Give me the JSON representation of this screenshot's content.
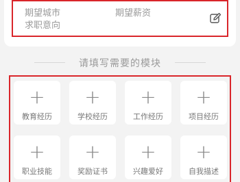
{
  "job_intention": {
    "expected_city_label": "期望城市",
    "expected_salary_label": "期望薪资",
    "job_intention_label": "求职意向",
    "edit_icon": "edit-icon"
  },
  "section": {
    "title": "请填写需要的模块"
  },
  "modules": [
    {
      "label": "教育经历"
    },
    {
      "label": "学校经历"
    },
    {
      "label": "工作经历"
    },
    {
      "label": "项目经历"
    },
    {
      "label": "职业技能"
    },
    {
      "label": "奖励证书"
    },
    {
      "label": "兴趣爱好"
    },
    {
      "label": "自我描述"
    }
  ],
  "colors": {
    "highlight": "#d9252a",
    "background": "#f3f3f3",
    "card": "#ffffff"
  }
}
